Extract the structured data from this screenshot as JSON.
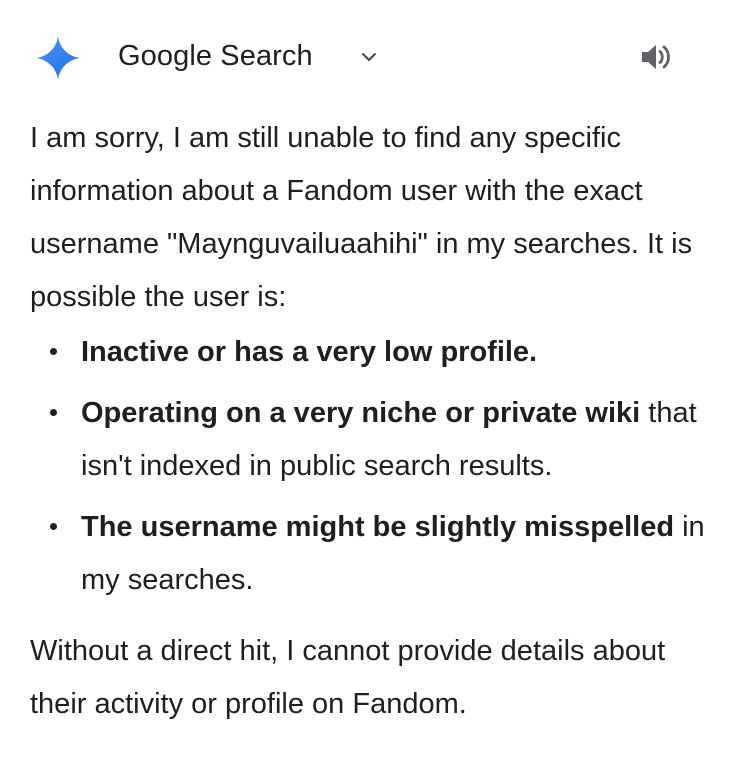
{
  "header": {
    "source_label": "Google Search",
    "logo_icon": "sparkle-icon",
    "dropdown_icon": "chevron-down-icon",
    "audio_icon": "speaker-icon",
    "accent_color": "#4285f4"
  },
  "response": {
    "intro": "I am sorry, I am still unable to find any specific information about a Fandom user with the exact username \"Maynguvailuaahihi\" in my searches. It is possible the user is:",
    "bullets": [
      {
        "bold": "Inactive or has a very low profile.",
        "rest": ""
      },
      {
        "bold": "Operating on a very niche or private wiki",
        "rest": " that isn't indexed in public search results."
      },
      {
        "bold": "The username might be slightly misspelled",
        "rest": " in my searches."
      }
    ],
    "closing": "Without a direct hit, I cannot provide details about their activity or profile on Fandom."
  }
}
